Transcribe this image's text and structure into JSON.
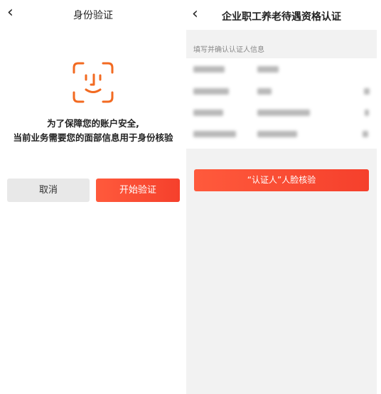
{
  "left": {
    "title": "身份验证",
    "back_icon": "‹",
    "message_line1": "为了保障您的账户安全,",
    "message_line2": "当前业务需要您的面部信息用于身份核验",
    "cancel_label": "取消",
    "start_label": "开始验证",
    "icon": "face-scan-icon",
    "accent": "#f5402c"
  },
  "right": {
    "title": "企业职工养老待遇资格认证",
    "back_icon": "‹",
    "section_label": "填写并确认认证人信息",
    "verify_label": "“认证人”人脸核验"
  }
}
